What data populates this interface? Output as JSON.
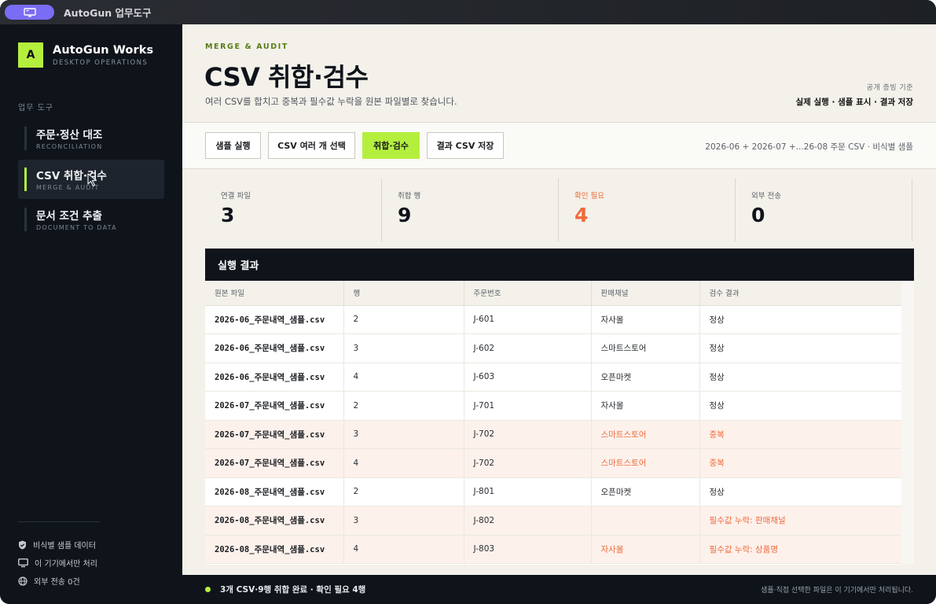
{
  "window": {
    "title": "AutoGun 업무도구"
  },
  "sidebar": {
    "brand_name": "AutoGun Works",
    "brand_sub": "DESKTOP OPERATIONS",
    "logo_letter": "A",
    "section_heading": "업무 도구",
    "items": [
      {
        "label": "주문·정산 대조",
        "sub": "RECONCILIATION",
        "active": false
      },
      {
        "label": "CSV 취합·검수",
        "sub": "MERGE & AUDIT",
        "active": true
      },
      {
        "label": "문서 조건 추출",
        "sub": "DOCUMENT TO DATA",
        "active": false
      }
    ],
    "footer": [
      {
        "icon": "shield-check-icon",
        "label": "비식별 샘플 데이터"
      },
      {
        "icon": "monitor-icon",
        "label": "이 기기에서만 처리"
      },
      {
        "icon": "globe-icon",
        "label": "외부 전송 0건"
      }
    ]
  },
  "header": {
    "eyebrow": "MERGE & AUDIT",
    "title": "CSV 취합·검수",
    "description": "여러 CSV를 합치고 중복과 필수값 누락을 원본 파일별로 찾습니다.",
    "meta_top": "공개 증빙 기준",
    "meta_bottom": "실제 실행 · 샘플 표시 · 결과 저장"
  },
  "toolbar": {
    "buttons": [
      "샘플 실행",
      "CSV 여러 개 선택",
      "취합·검수",
      "결과 CSV 저장"
    ],
    "meta": "2026-06  +  2026-07  +...26-08 주문 CSV · 비식별 샘플"
  },
  "stats": [
    {
      "label": "연결 파일",
      "value": "3",
      "alert": false
    },
    {
      "label": "취합 행",
      "value": "9",
      "alert": false
    },
    {
      "label": "확인 필요",
      "value": "4",
      "alert": true
    },
    {
      "label": "외부 전송",
      "value": "0",
      "alert": false
    }
  ],
  "results": {
    "title": "실행 결과",
    "columns": [
      "원본 파일",
      "행",
      "주문번호",
      "판매채널",
      "검수 결과"
    ],
    "rows": [
      {
        "file": "2026-06_주문내역_샘플.csv",
        "row": "2",
        "order": "J-601",
        "channel": "자사몰",
        "result": "정상",
        "warn": false
      },
      {
        "file": "2026-06_주문내역_샘플.csv",
        "row": "3",
        "order": "J-602",
        "channel": "스마트스토어",
        "result": "정상",
        "warn": false
      },
      {
        "file": "2026-06_주문내역_샘플.csv",
        "row": "4",
        "order": "J-603",
        "channel": "오픈마켓",
        "result": "정상",
        "warn": false
      },
      {
        "file": "2026-07_주문내역_샘플.csv",
        "row": "2",
        "order": "J-701",
        "channel": "자사몰",
        "result": "정상",
        "warn": false
      },
      {
        "file": "2026-07_주문내역_샘플.csv",
        "row": "3",
        "order": "J-702",
        "channel": "스마트스토어",
        "result": "중복",
        "warn": true
      },
      {
        "file": "2026-07_주문내역_샘플.csv",
        "row": "4",
        "order": "J-702",
        "channel": "스마트스토어",
        "result": "중복",
        "warn": true
      },
      {
        "file": "2026-08_주문내역_샘플.csv",
        "row": "2",
        "order": "J-801",
        "channel": "오픈마켓",
        "result": "정상",
        "warn": false
      },
      {
        "file": "2026-08_주문내역_샘플.csv",
        "row": "3",
        "order": "J-802",
        "channel": "",
        "result": "필수값 누락: 판매채널",
        "warn": true
      },
      {
        "file": "2026-08_주문내역_샘플.csv",
        "row": "4",
        "order": "J-803",
        "channel": "자사몰",
        "result": "필수값 누락: 상품명",
        "warn": true
      }
    ]
  },
  "status": {
    "left": "3개 CSV·9행 취합 완료 · 확인 필요 4행",
    "right": "샘플·직접 선택한 파일은 이 기기에서만 처리됩니다."
  },
  "colors": {
    "accent": "#b5ef3e",
    "alert": "#f06a3a",
    "sidebar": "#0f141b",
    "main_bg": "#f3f1ea"
  }
}
